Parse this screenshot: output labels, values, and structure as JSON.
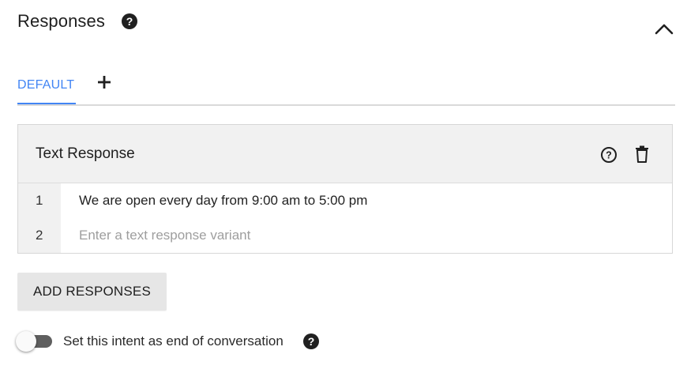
{
  "section": {
    "title": "Responses",
    "help_icon": "help-circle-icon",
    "collapse_icon": "chevron-up-icon"
  },
  "tabs": {
    "items": [
      {
        "label": "DEFAULT",
        "active": true
      }
    ],
    "add_icon": "plus-icon"
  },
  "text_response": {
    "title": "Text Response",
    "help_icon": "help-outline-icon",
    "delete_icon": "trash-icon",
    "rows": [
      {
        "index": "1",
        "value": "We are open every day from 9:00 am to 5:00 pm"
      },
      {
        "index": "2",
        "value": "",
        "placeholder": "Enter a text response variant"
      }
    ]
  },
  "add_button": {
    "label": "ADD RESPONSES"
  },
  "end_conversation": {
    "label": "Set this intent as end of conversation",
    "enabled": false,
    "help_icon": "help-circle-icon"
  },
  "colors": {
    "accent": "#4285f4",
    "card_header_bg": "#f1f1f1",
    "button_bg": "#e6e6e6",
    "toggle_track": "#5f5f5f"
  }
}
